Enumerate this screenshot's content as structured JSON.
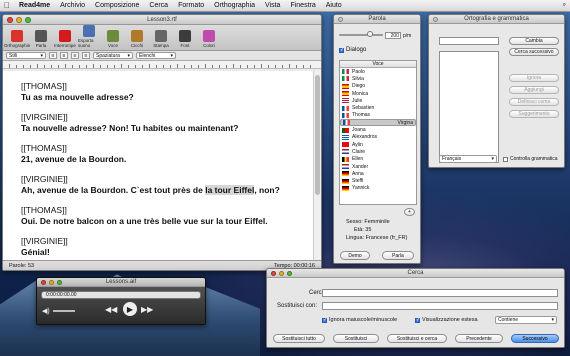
{
  "menubar": {
    "apple": "",
    "items": [
      "Read4me",
      "Archivio",
      "Composizione",
      "Cerca",
      "Formato",
      "Orthographia",
      "Vista",
      "Finestra",
      "Aiuto"
    ],
    "right_text": "⌕"
  },
  "editor": {
    "title": "Lesson3.rtf",
    "toolbar": [
      {
        "label": "Orthographie",
        "icon": "orthographie-icon",
        "color": "#d9342b"
      },
      {
        "label": "Parla",
        "icon": "speak-icon",
        "color": "#555555"
      },
      {
        "label": "Interrompe",
        "icon": "stop-icon",
        "color": "#d41a1a"
      },
      {
        "label": "Esporta suono",
        "icon": "export-sound-icon",
        "color": "#4b6fb0"
      },
      {
        "label": "Voce",
        "icon": "voice-icon",
        "color": "#6b8c3a"
      },
      {
        "label": "Cicchi",
        "icon": "cicchi-icon",
        "color": "#b07a2a"
      },
      {
        "label": "Stampa",
        "icon": "print-icon",
        "color": "#666666"
      },
      {
        "label": "Font",
        "icon": "font-icon",
        "color": "#3c3c3c"
      },
      {
        "label": "Colori",
        "icon": "colors-icon",
        "color": "#c04ab0"
      }
    ],
    "format": {
      "style": "Stili",
      "spacing": "Spaziatura",
      "list": "Elenchi"
    },
    "lines": [
      {
        "text": "[[THOMAS]]",
        "bold": false
      },
      {
        "text": "Tu as ma nouvelle adresse?",
        "bold": true
      },
      {
        "text": "",
        "gap": true
      },
      {
        "text": "[[VIRGINIE]]",
        "bold": false
      },
      {
        "text": "Ta nouvelle adresse? Non! Tu habites ou maintenant?",
        "bold": true
      },
      {
        "text": "",
        "gap": true
      },
      {
        "text": "[[THOMAS]]",
        "bold": false
      },
      {
        "text": "21, avenue de la Bourdon.",
        "bold": true
      },
      {
        "text": "",
        "gap": true
      },
      {
        "text": "[[VIRGINIE]]",
        "bold": false
      },
      {
        "text_before": "Ah, avenue de la Bourdon. C`est tout près de ",
        "highlight": "la tour Eiffel",
        "text_after": ", non?",
        "bold": true
      },
      {
        "text": "",
        "gap": true
      },
      {
        "text": "[[THOMAS]]",
        "bold": false
      },
      {
        "text": "Oui. De notre balcon on a une très belle vue sur la tour Eiffel.",
        "bold": true
      },
      {
        "text": "",
        "gap": true
      },
      {
        "text": "[[VIRGINIE]]",
        "bold": false
      },
      {
        "text": "Génial!",
        "bold": true
      }
    ],
    "status_left": "Parole: 53",
    "status_right": "Tempo: 00:00:16"
  },
  "voice_panel": {
    "title": "Parola",
    "rate_value": "200",
    "rate_unit": "p/m",
    "dialog_label": "Dialogo",
    "list_header": "Voce",
    "voices": [
      {
        "name": "Paolo",
        "flag": "it"
      },
      {
        "name": "Silvia",
        "flag": "it"
      },
      {
        "name": "Diego",
        "flag": "es"
      },
      {
        "name": "Monica",
        "flag": "es"
      },
      {
        "name": "Julie",
        "flag": "us"
      },
      {
        "name": "Sebastien",
        "flag": "fr"
      },
      {
        "name": "Thomas",
        "flag": "fr"
      },
      {
        "name": "Virgina",
        "flag": "fr",
        "selected": true
      },
      {
        "name": "Joana",
        "flag": "pt"
      },
      {
        "name": "Alexandros",
        "flag": "gr"
      },
      {
        "name": "Aylin",
        "flag": "tr"
      },
      {
        "name": "Claire",
        "flag": "nl"
      },
      {
        "name": "Ellen",
        "flag": "be"
      },
      {
        "name": "Xander",
        "flag": "nl"
      },
      {
        "name": "Anna",
        "flag": "de"
      },
      {
        "name": "Steffi",
        "flag": "de"
      },
      {
        "name": "Yannick",
        "flag": "de"
      }
    ],
    "add_button": "+",
    "sex_label": "Sesso: Femminile",
    "age_label": "Età: 35",
    "lang_label": "Lingua: Francese (fr_FR)",
    "demo_button": "Demo",
    "speak_button": "Parla"
  },
  "spelling": {
    "title": "Ortografia e grammatica",
    "change_button": "Cambia",
    "find_next_button": "Cerca successivo",
    "ignore_button": "Ignora",
    "learn_button": "Aggiungi",
    "define_button": "Definisci come",
    "suggest_button": "Suggerimento",
    "language": "Français",
    "grammar_label": "Controlla grammatica"
  },
  "player": {
    "title": "Lessons.aif",
    "time": "0:00:00:00.00"
  },
  "find": {
    "title": "Cerca",
    "find_label": "Cerca:",
    "replace_label": "Sostituisci con:",
    "ignore_case_label": "Ignora maiuscole/minuscole",
    "wrap_label": "Visualizzazione estesa",
    "mode": "Contiene",
    "replace_all": "Sostituisci tutto",
    "replace": "Sostituisci",
    "replace_find": "Sostituisci e cerca",
    "previous": "Precedente",
    "next": "Successivo"
  },
  "colors": {
    "accent": "#3d7be0",
    "highlight": "#d6d6d6"
  }
}
